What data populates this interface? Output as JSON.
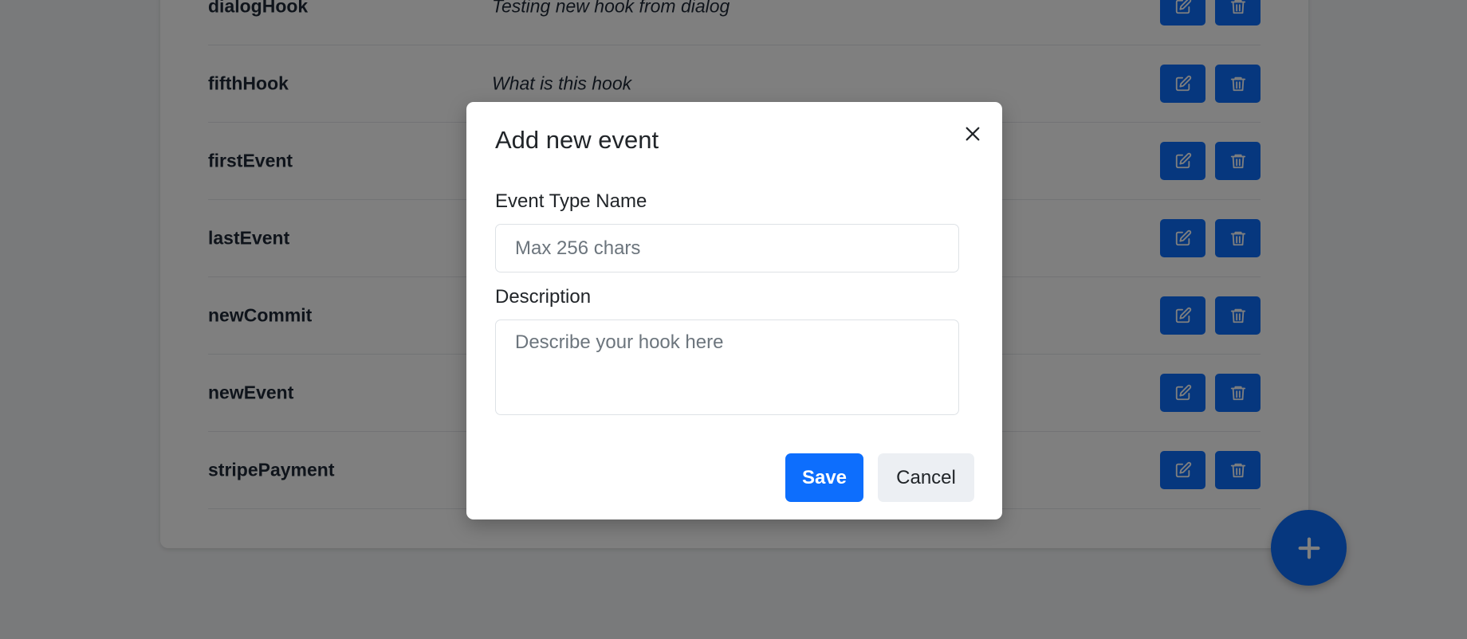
{
  "table": {
    "rows": [
      {
        "name": "dialogHook",
        "description": "Testing new hook from dialog"
      },
      {
        "name": "fifthHook",
        "description": "What is this hook"
      },
      {
        "name": "firstEvent",
        "description": ""
      },
      {
        "name": "lastEvent",
        "description": ""
      },
      {
        "name": "newCommit",
        "description": ""
      },
      {
        "name": "newEvent",
        "description": ""
      },
      {
        "name": "stripePayment",
        "description": ""
      }
    ],
    "edit_icon": "edit-icon",
    "delete_icon": "trash-icon"
  },
  "fab": {
    "icon": "plus-icon"
  },
  "modal": {
    "title": "Add new event",
    "close_icon": "close-icon",
    "name_label": "Event Type Name",
    "name_placeholder": "Max 256 chars",
    "name_value": "",
    "description_label": "Description",
    "description_placeholder": "Describe your hook here",
    "description_value": "",
    "save_label": "Save",
    "cancel_label": "Cancel"
  },
  "colors": {
    "primary": "#0d6efd",
    "backdrop": "rgba(0,0,0,0.5)",
    "cancel_bg": "#eceff3"
  }
}
